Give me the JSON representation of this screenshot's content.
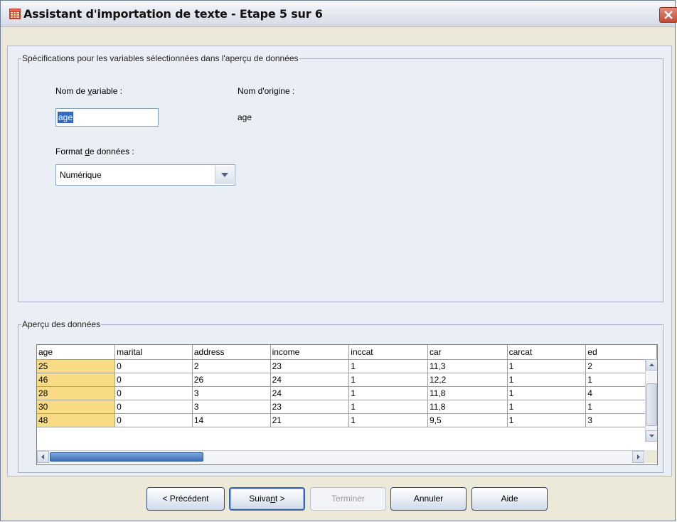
{
  "window": {
    "title": "Assistant d'importation de texte - Etape 5 sur 6"
  },
  "spec_group": {
    "legend": "Spécifications pour les variables sélectionnées dans l'aperçu de données",
    "var_name_label_pre": "Nom de ",
    "var_name_label_u": "v",
    "var_name_label_post": "ariable :",
    "var_name_value": "age",
    "orig_name_label": "Nom d'origine :",
    "orig_name_value": "age",
    "format_label_pre": "Format ",
    "format_label_u": "d",
    "format_label_post": "e données :",
    "format_value": "Numérique"
  },
  "preview_group": {
    "legend": "Aperçu des données",
    "columns": [
      "age",
      "marital",
      "address",
      "income",
      "inccat",
      "car",
      "carcat",
      "ed"
    ],
    "rows": [
      [
        "25",
        "0",
        "2",
        "23",
        "1",
        "11,3",
        "1",
        "2"
      ],
      [
        "46",
        "0",
        "26",
        "24",
        "1",
        "12,2",
        "1",
        "1"
      ],
      [
        "28",
        "0",
        "3",
        "24",
        "1",
        "11,8",
        "1",
        "4"
      ],
      [
        "30",
        "0",
        "3",
        "23",
        "1",
        "11,8",
        "1",
        "1"
      ],
      [
        "48",
        "0",
        "14",
        "21",
        "1",
        "9,5",
        "1",
        "3"
      ]
    ]
  },
  "buttons": {
    "previous": "< Précédent",
    "next_pre": "Suiva",
    "next_u": "n",
    "next_post": "t >",
    "finish": "Terminer",
    "cancel": "Annuler",
    "help": "Aide"
  }
}
